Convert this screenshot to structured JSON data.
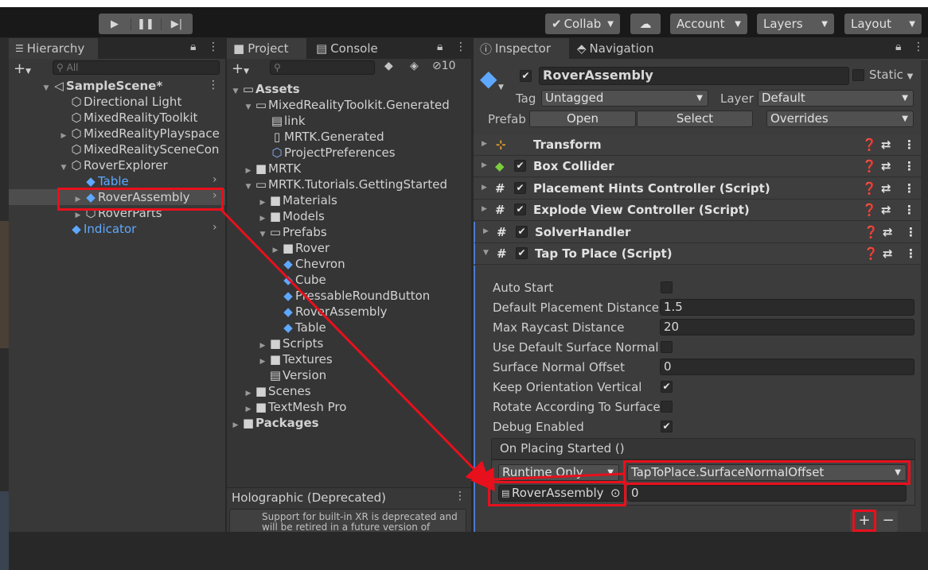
{
  "toolbar": {
    "play_icon": "play-icon",
    "pause_icon": "pause-icon",
    "step_icon": "step-icon",
    "collab": "Collab",
    "account": "Account",
    "layers": "Layers",
    "layout": "Layout"
  },
  "hierarchy": {
    "tab": "Hierarchy",
    "search_placeholder": "All",
    "items": [
      {
        "label": "SampleScene*"
      },
      {
        "label": "Directional Light"
      },
      {
        "label": "MixedRealityToolkit"
      },
      {
        "label": "MixedRealityPlayspace"
      },
      {
        "label": "MixedRealitySceneCon"
      },
      {
        "label": "RoverExplorer"
      },
      {
        "label": "Table"
      },
      {
        "label": "RoverAssembly"
      },
      {
        "label": "RoverParts"
      },
      {
        "label": "Indicator"
      }
    ]
  },
  "project": {
    "tabs": [
      "Project",
      "Console"
    ],
    "hidden_count": "10",
    "items": [
      {
        "label": "Assets"
      },
      {
        "label": "MixedRealityToolkit.Generated"
      },
      {
        "label": "link"
      },
      {
        "label": "MRTK.Generated"
      },
      {
        "label": "ProjectPreferences"
      },
      {
        "label": "MRTK"
      },
      {
        "label": "MRTK.Tutorials.GettingStarted"
      },
      {
        "label": "Materials"
      },
      {
        "label": "Models"
      },
      {
        "label": "Prefabs"
      },
      {
        "label": "Rover"
      },
      {
        "label": "Chevron"
      },
      {
        "label": "Cube"
      },
      {
        "label": "PressableRoundButton"
      },
      {
        "label": "RoverAssembly"
      },
      {
        "label": "Table"
      },
      {
        "label": "Scripts"
      },
      {
        "label": "Textures"
      },
      {
        "label": "Version"
      },
      {
        "label": "Scenes"
      },
      {
        "label": "TextMesh Pro"
      },
      {
        "label": "Packages"
      }
    ],
    "holo_title": "Holographic (Deprecated)",
    "holo_text": "Support for built-in XR is deprecated and will be retired in a future version of"
  },
  "inspector": {
    "tabs": [
      "Inspector",
      "Navigation"
    ],
    "object_name": "RoverAssembly",
    "static_label": "Static",
    "tag_label": "Tag",
    "tag_value": "Untagged",
    "layer_label": "Layer",
    "layer_value": "Default",
    "prefab_label": "Prefab",
    "open": "Open",
    "select": "Select",
    "overrides": "Overrides",
    "components": [
      "Transform",
      "Box Collider",
      "Placement Hints Controller (Script)",
      "Explode View Controller (Script)",
      "SolverHandler",
      "Tap To Place (Script)"
    ],
    "props": [
      {
        "label": "Auto Start",
        "value": "",
        "checked": false
      },
      {
        "label": "Default Placement Distance",
        "value": "1.5"
      },
      {
        "label": "Max Raycast Distance",
        "value": "20"
      },
      {
        "label": "Use Default Surface Normal O",
        "value": "",
        "checked": false
      },
      {
        "label": "Surface Normal Offset",
        "value": "0"
      },
      {
        "label": "Keep Orientation Vertical",
        "value": "",
        "checked": true
      },
      {
        "label": "Rotate According To Surface",
        "value": "",
        "checked": false
      },
      {
        "label": "Debug Enabled",
        "value": "",
        "checked": true
      }
    ],
    "event_title": "On Placing Started ()",
    "event_mode": "Runtime Only",
    "event_function": "TapToPlace.SurfaceNormalOffset",
    "event_object": "RoverAssembly",
    "event_arg": "0",
    "add_label": "+",
    "remove_label": "−"
  },
  "colors": {
    "accent_red": "#e8101c",
    "link_blue": "#5ea8ff"
  }
}
